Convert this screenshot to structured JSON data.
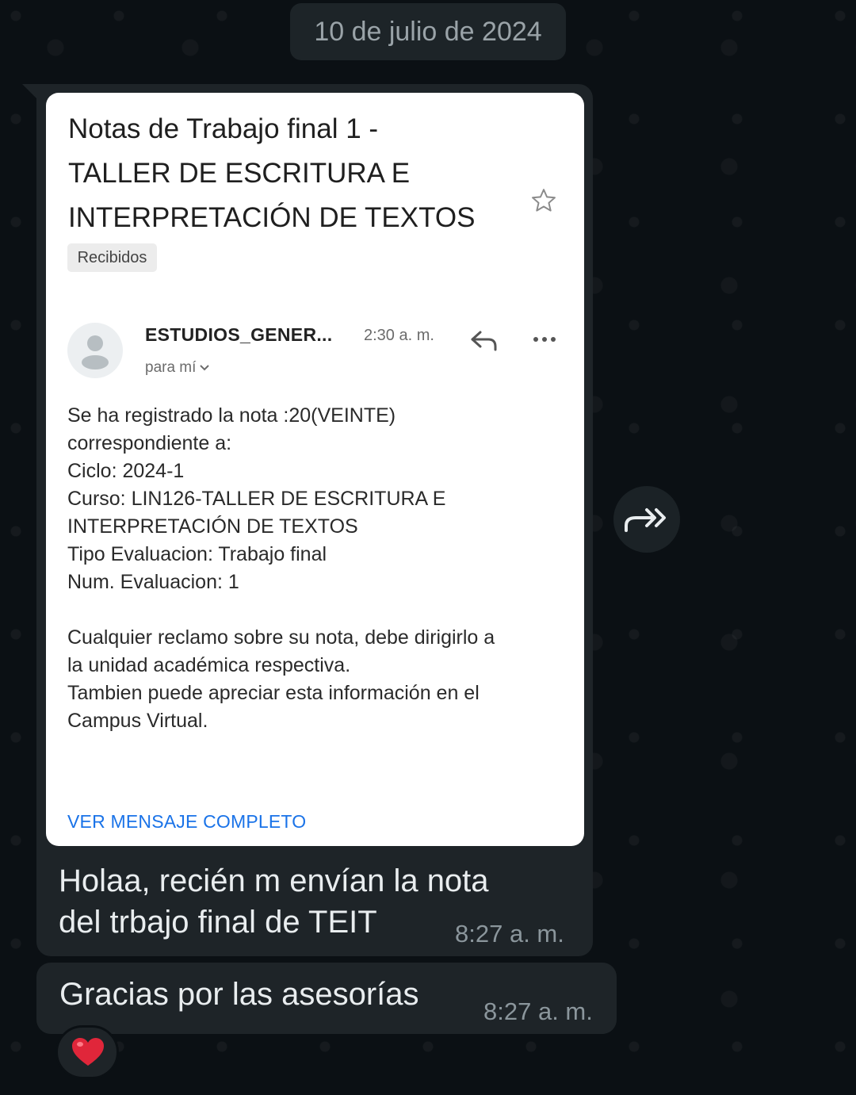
{
  "date_separator": "10 de julio de 2024",
  "email": {
    "subject_lines": [
      "Notas de Trabajo final 1 -",
      "TALLER DE ESCRITURA E",
      "INTERPRETACIÓN DE TEXTOS"
    ],
    "label": "Recibidos",
    "sender": "ESTUDIOS_GENER...",
    "time": "2:30 a. m.",
    "recipient": "para mí",
    "body_lines": [
      "Se ha registrado la nota :20(VEINTE)",
      "correspondiente a:",
      "Ciclo: 2024-1",
      "Curso: LIN126-TALLER DE ESCRITURA E",
      "INTERPRETACIÓN DE TEXTOS",
      "Tipo Evaluacion: Trabajo final",
      "Num. Evaluacion: 1"
    ],
    "body_lines_2": [
      "Cualquier reclamo sobre su nota, debe dirigirlo a",
      "la unidad académica respectiva.",
      "Tambien puede apreciar esta información en el",
      "Campus Virtual."
    ],
    "view_full_label": "VER MENSAJE COMPLETO"
  },
  "messages": [
    {
      "text_lines": [
        "Holaa, recién m envían la nota",
        "del trbajo final de TEIT"
      ],
      "time": "8:27 a. m."
    },
    {
      "text": "Gracias por las asesorías",
      "time": "8:27 a. m."
    }
  ],
  "icons": {
    "star": "star-outline-icon",
    "reply": "reply-icon",
    "more": "more-horizontal-icon",
    "forward": "forward-icon",
    "reaction": "red-heart-icon"
  },
  "colors": {
    "background": "#0b1014",
    "bubble": "#1e2428",
    "link": "#1a73e8",
    "heart": "#e0263a"
  }
}
